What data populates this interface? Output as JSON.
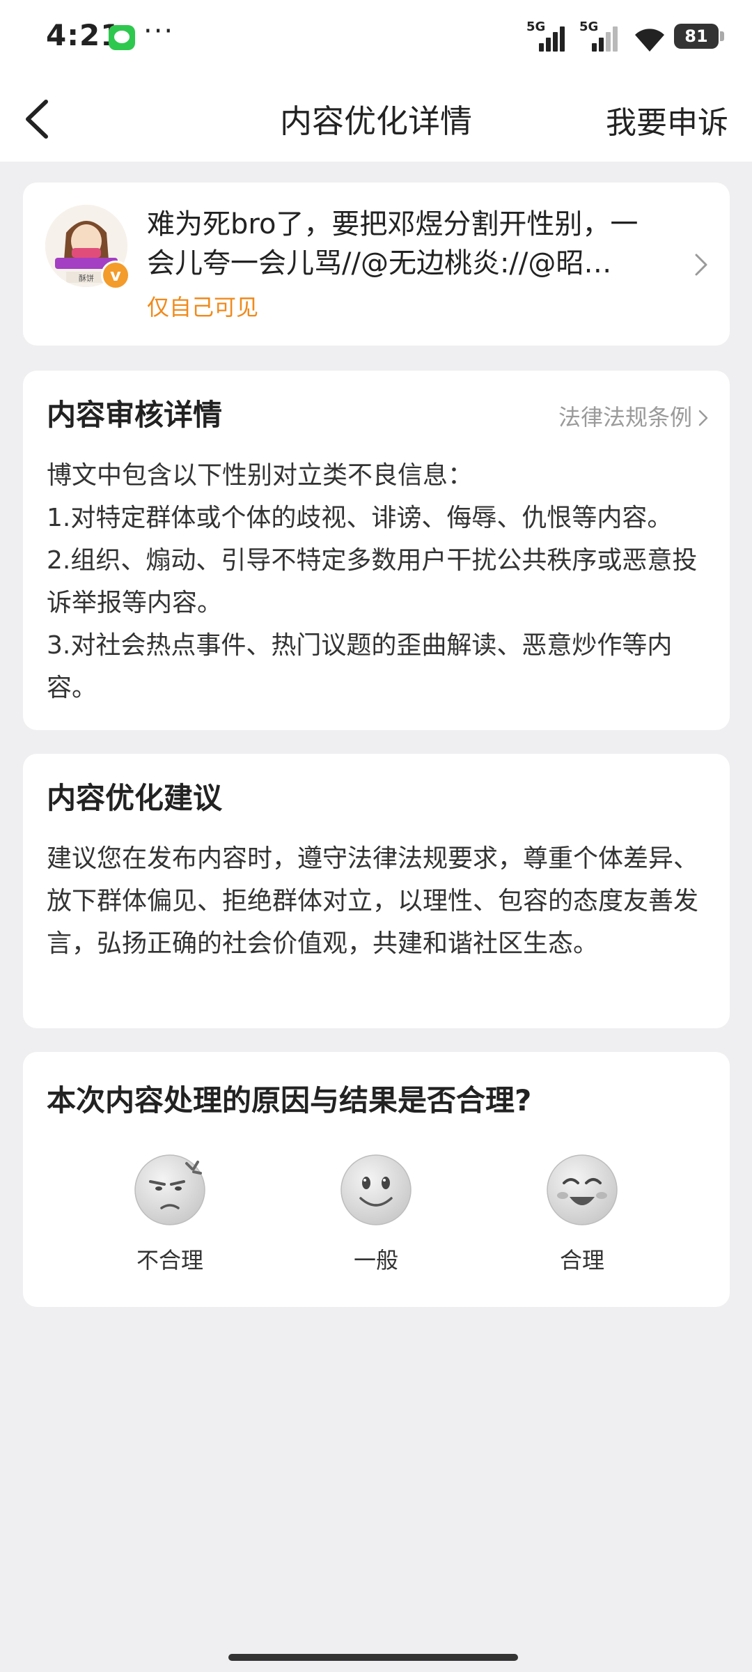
{
  "status_bar": {
    "time": "4:21",
    "signal1_label": "5G",
    "signal2_label": "5G",
    "battery": "81"
  },
  "nav": {
    "title": "内容优化详情",
    "appeal_label": "我要申诉"
  },
  "post": {
    "text": "难为死bro了，要把邓煜分割开性别，一会儿夸一会儿骂//@无边桃炎://@昭…",
    "visibility": "仅自己可见",
    "avatar_caption": "酥饼"
  },
  "review": {
    "title": "内容审核详情",
    "laws_link": "法律法规条例",
    "lines": [
      "博文中包含以下性别对立类不良信息：",
      "1.对特定群体或个体的歧视、诽谤、侮辱、仇恨等内容。",
      "2.组织、煽动、引导不特定多数用户干扰公共秩序或恶意投诉举报等内容。",
      "3.对社会热点事件、热门议题的歪曲解读、恶意炒作等内容。"
    ]
  },
  "advice": {
    "title": "内容优化建议",
    "text": "建议您在发布内容时，遵守法律法规要求，尊重个体差异、放下群体偏见、拒绝群体对立，以理性、包容的态度友善发言，弘扬正确的社会价值观，共建和谐社区生态。"
  },
  "feedback": {
    "question": "本次内容处理的原因与结果是否合理?",
    "options": [
      {
        "label": "不合理",
        "icon": "angry-face-icon"
      },
      {
        "label": "一般",
        "icon": "neutral-face-icon"
      },
      {
        "label": "合理",
        "icon": "happy-face-icon"
      }
    ]
  },
  "colors": {
    "accent_orange": "#f08a1c",
    "background": "#efeff1",
    "card": "#ffffff",
    "muted_text": "#9a9a9a"
  }
}
